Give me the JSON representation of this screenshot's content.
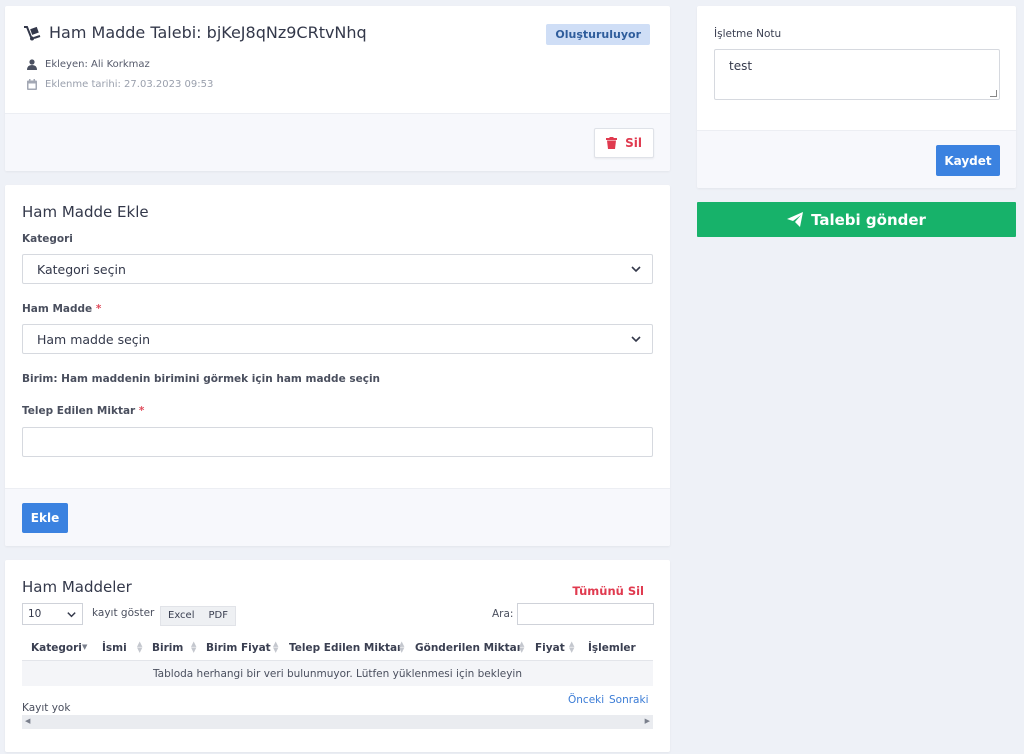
{
  "request": {
    "title": "Ham Madde Talebi: bjKeJ8qNz9CRtvNhq",
    "status": "Oluşturuluyor",
    "added_by": "Ekleyen: Ali Korkmaz",
    "added_date": "Eklenme tarihi: 27.03.2023 09:53",
    "delete_label": "Sil"
  },
  "add_form": {
    "title": "Ham Madde Ekle",
    "category_label": "Kategori",
    "category_value": "Kategori seçin",
    "material_label": "Ham Madde",
    "material_value": "Ham madde seçin",
    "required_mark": "*",
    "unit_text": "Birim: Ham maddenin birimini görmek için ham madde seçin",
    "quantity_label": "Telep Edilen Miktar",
    "quantity_value": "",
    "add_button": "Ekle"
  },
  "list": {
    "title": "Ham Maddeler",
    "delete_all": "Tümünü Sil",
    "page_length": "10",
    "show_records": "kayıt göster",
    "export_excel": "Excel",
    "export_pdf": "PDF",
    "search_label": "Ara:",
    "search_value": "",
    "columns": [
      "Kategori",
      "İsmi",
      "Birim",
      "Birim Fiyat",
      "Telep Edilen Miktar",
      "Gönderilen Miktar",
      "Fiyat",
      "İşlemler"
    ],
    "empty_message": "Tabloda herhangi bir veri bulunmuyor. Lütfen yüklenmesi için bekleyin",
    "info": "Kayıt yok",
    "prev": "Önceki",
    "next": "Sonraki"
  },
  "note": {
    "label": "İşletme Notu",
    "value": "test",
    "save_button": "Kaydet"
  },
  "send_button": "Talebi gönder",
  "colors": {
    "primary": "#3b82e0",
    "danger": "#e03a4f",
    "success": "#17b26a",
    "badge_bg": "#cfdef6"
  }
}
